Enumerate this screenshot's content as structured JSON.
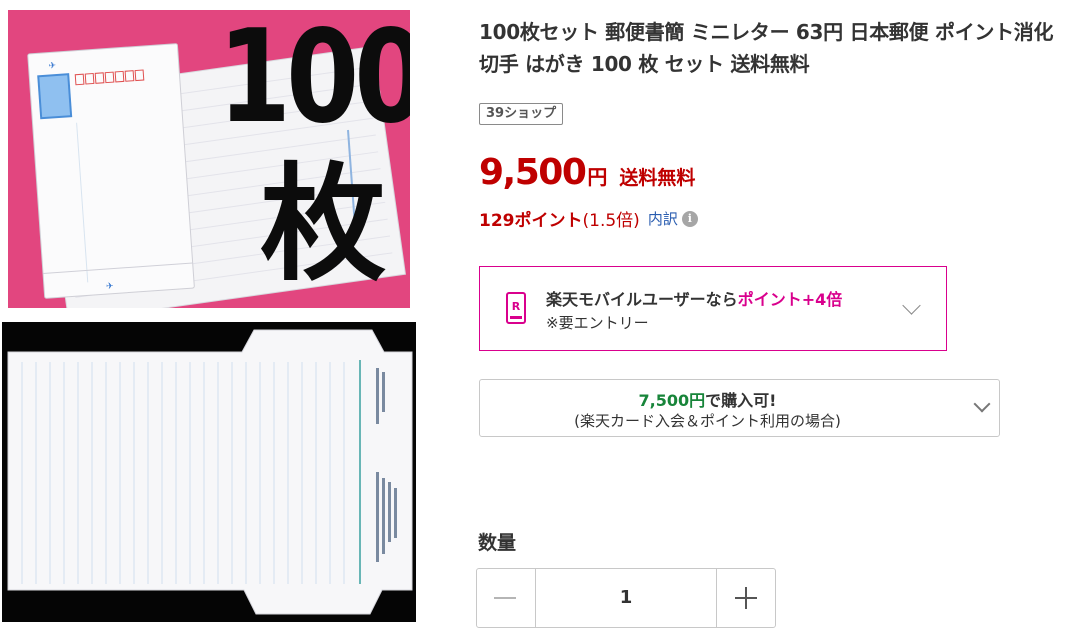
{
  "product": {
    "title": "100枚セット 郵便書簡 ミニレター 63円 日本郵便 ポイント消化 切手 はがき 100 枚 セット 送料無料",
    "shop_badge": "39ショップ",
    "image_1": {
      "big_text_number": "100",
      "big_text_unit": "枚"
    }
  },
  "price": {
    "amount": "9,500",
    "currency": "円",
    "shipping": "送料無料"
  },
  "points": {
    "text": "129ポイント",
    "multiplier": "(1.5倍)",
    "breakdown_link": "内訳",
    "info_icon_glyph": "i"
  },
  "mobile_promo": {
    "icon_letter": "R",
    "line1_prefix": "楽天モバイルユーザーなら",
    "line1_highlight": "ポイント+4倍",
    "line2": "※要エントリー",
    "accent_color": "#d9008d"
  },
  "card_promo": {
    "price": "7,500円",
    "suffix": "で購入可!",
    "note": "(楽天カード入会＆ポイント利用の場合)",
    "accent_color": "#18853a"
  },
  "quantity": {
    "label": "数量",
    "value": "1"
  },
  "colors": {
    "price_red": "#bf0000",
    "link_blue": "#2a5db0",
    "image_bg_pink": "#e2467f"
  }
}
